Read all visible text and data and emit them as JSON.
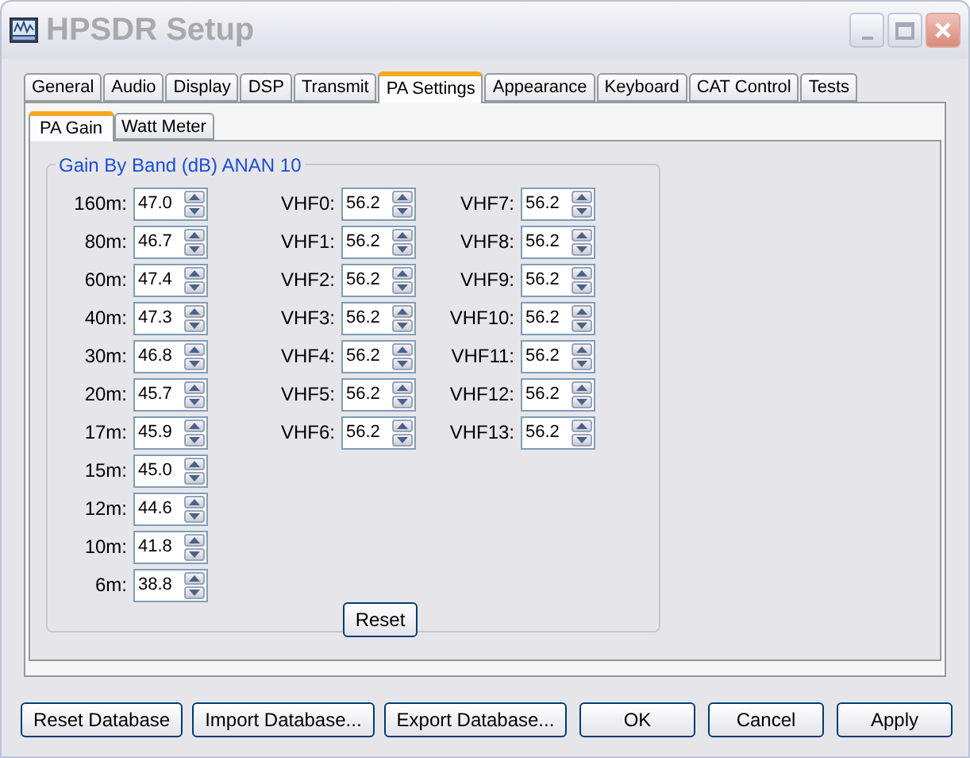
{
  "window": {
    "title": "HPSDR Setup"
  },
  "tabs": [
    {
      "label": "General",
      "selected": false
    },
    {
      "label": "Audio",
      "selected": false
    },
    {
      "label": "Display",
      "selected": false
    },
    {
      "label": "DSP",
      "selected": false
    },
    {
      "label": "Transmit",
      "selected": false
    },
    {
      "label": "PA Settings",
      "selected": true
    },
    {
      "label": "Appearance",
      "selected": false
    },
    {
      "label": "Keyboard",
      "selected": false
    },
    {
      "label": "CAT Control",
      "selected": false
    },
    {
      "label": "Tests",
      "selected": false
    }
  ],
  "subtabs": [
    {
      "label": "PA Gain",
      "selected": true
    },
    {
      "label": "Watt Meter",
      "selected": false
    }
  ],
  "group": {
    "title": "Gain By Band (dB) ANAN 10",
    "columns": [
      [
        {
          "label": "160m:",
          "value": "47.0"
        },
        {
          "label": "80m:",
          "value": "46.7"
        },
        {
          "label": "60m:",
          "value": "47.4"
        },
        {
          "label": "40m:",
          "value": "47.3"
        },
        {
          "label": "30m:",
          "value": "46.8"
        },
        {
          "label": "20m:",
          "value": "45.7"
        },
        {
          "label": "17m:",
          "value": "45.9"
        },
        {
          "label": "15m:",
          "value": "45.0"
        },
        {
          "label": "12m:",
          "value": "44.6"
        },
        {
          "label": "10m:",
          "value": "41.8"
        },
        {
          "label": "6m:",
          "value": "38.8"
        }
      ],
      [
        {
          "label": "VHF0:",
          "value": "56.2"
        },
        {
          "label": "VHF1:",
          "value": "56.2"
        },
        {
          "label": "VHF2:",
          "value": "56.2"
        },
        {
          "label": "VHF3:",
          "value": "56.2"
        },
        {
          "label": "VHF4:",
          "value": "56.2"
        },
        {
          "label": "VHF5:",
          "value": "56.2"
        },
        {
          "label": "VHF6:",
          "value": "56.2"
        }
      ],
      [
        {
          "label": "VHF7:",
          "value": "56.2"
        },
        {
          "label": "VHF8:",
          "value": "56.2"
        },
        {
          "label": "VHF9:",
          "value": "56.2"
        },
        {
          "label": "VHF10:",
          "value": "56.2"
        },
        {
          "label": "VHF11:",
          "value": "56.2"
        },
        {
          "label": "VHF12:",
          "value": "56.2"
        },
        {
          "label": "VHF13:",
          "value": "56.2"
        }
      ]
    ],
    "reset_button": "Reset"
  },
  "footer": {
    "left_buttons": [
      "Reset Database",
      "Import Database...",
      "Export Database..."
    ],
    "right_buttons": [
      "OK",
      "Cancel",
      "Apply"
    ]
  }
}
